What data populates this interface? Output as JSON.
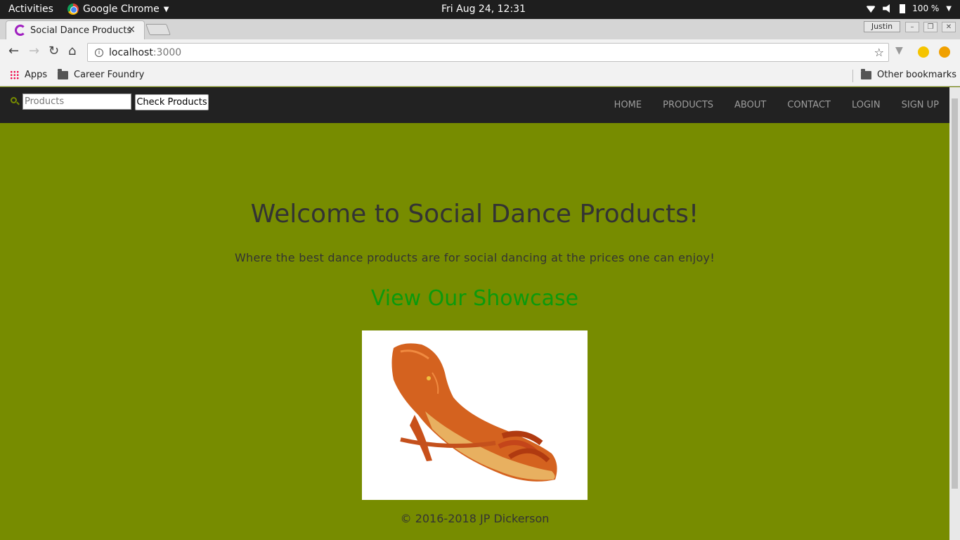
{
  "system": {
    "activities": "Activities",
    "app_name": "Google Chrome",
    "clock": "Fri Aug 24, 12:31",
    "battery": "100 %"
  },
  "browser": {
    "tab_title": "Social Dance Products",
    "tab_close": "×",
    "profile": "Justin",
    "url_host": "localhost",
    "url_port": ":3000",
    "bookmarks": [
      {
        "label": "Apps"
      },
      {
        "label": "Career Foundry"
      }
    ],
    "other_bookmarks": "Other bookmarks"
  },
  "site": {
    "search_placeholder": "Products",
    "search_value": "",
    "check_button": "Check Products",
    "nav": [
      "HOME",
      "PRODUCTS",
      "ABOUT",
      "CONTACT",
      "LOGIN",
      "SIGN UP"
    ],
    "title": "Welcome to Social Dance Products!",
    "subtitle": "Where the best dance products are for social dancing at the prices one can enjoy!",
    "showcase_link": "View Our Showcase",
    "footer": "© 2016-2018 JP Dickerson",
    "brand_color": "#778c00",
    "link_color": "#0c9a0c"
  },
  "icons": [
    "chrome-icon",
    "wifi-icon",
    "volume-icon",
    "battery-icon",
    "back-icon",
    "forward-icon",
    "reload-icon",
    "home-icon",
    "info-icon",
    "star-icon",
    "search-icon",
    "folder-icon",
    "apps-icon"
  ]
}
